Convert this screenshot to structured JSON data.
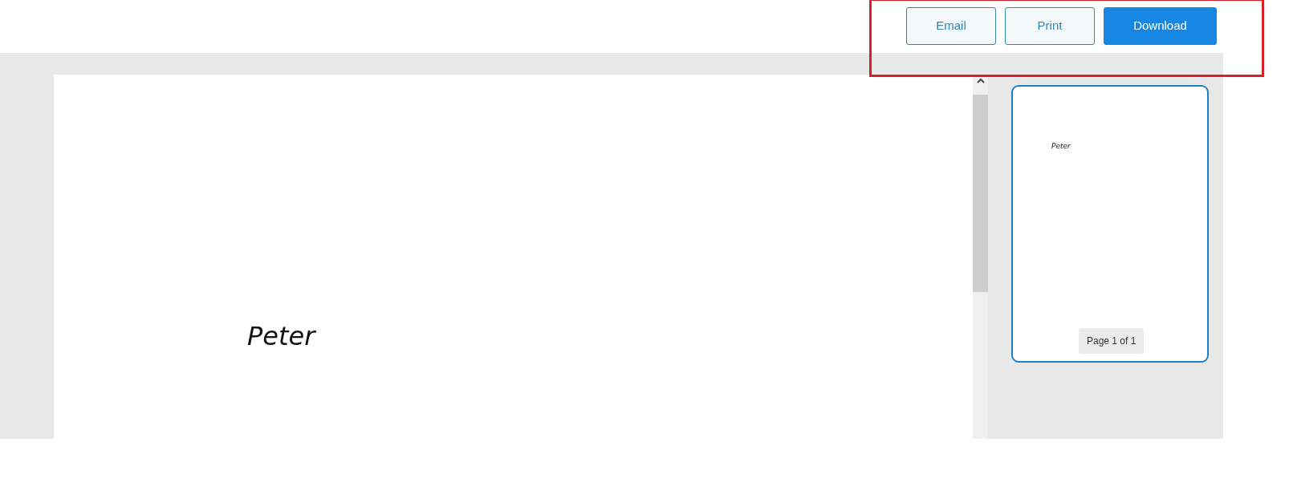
{
  "toolbar": {
    "buttons": [
      {
        "label": "Email",
        "kind": "outline"
      },
      {
        "label": "Print",
        "kind": "outline"
      },
      {
        "label": "Download",
        "kind": "primary"
      }
    ]
  },
  "document": {
    "signature": "Peter"
  },
  "thumbnails": [
    {
      "signature": "Peter",
      "page_label": "Page 1 of 1",
      "selected": true
    }
  ]
}
